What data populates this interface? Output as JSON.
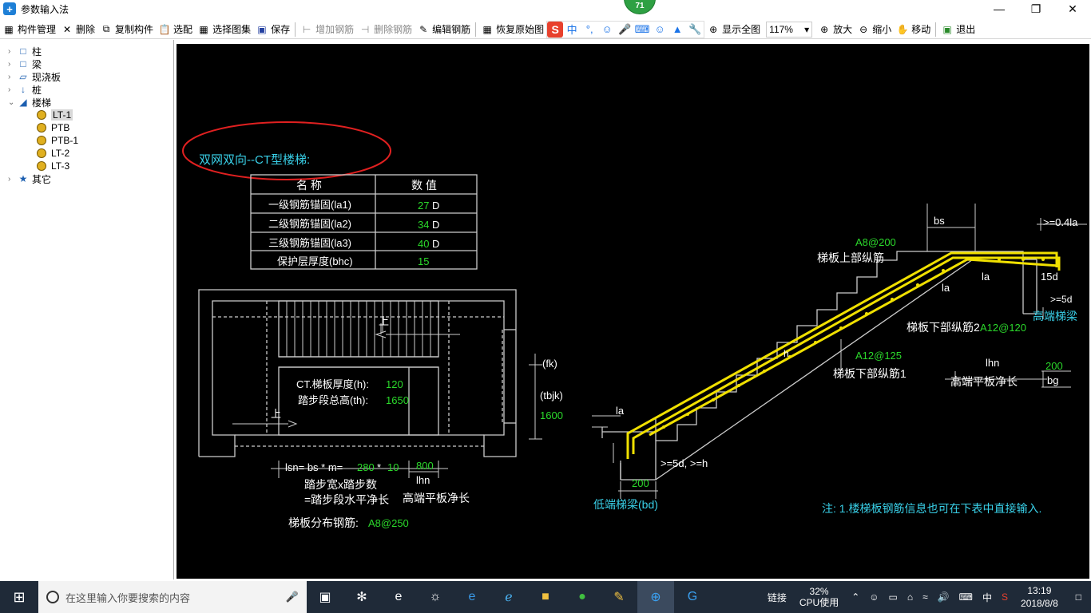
{
  "window": {
    "title": "参数输入法",
    "badge": "71"
  },
  "toolbar": {
    "items": [
      "构件管理",
      "删除",
      "复制构件",
      "选配",
      "选择图集",
      "保存",
      "增加钢筋",
      "删除钢筋",
      "编辑钢筋",
      "恢复原始图"
    ],
    "zoom_value": "117%",
    "right_items": [
      "显示全图",
      "放大",
      "缩小",
      "移动",
      "退出"
    ]
  },
  "tree": {
    "root": [
      "柱",
      "梁",
      "现浇板",
      "桩",
      "楼梯",
      "其它"
    ],
    "stairs_children": [
      "LT-1",
      "PTB",
      "PTB-1",
      "LT-2",
      "LT-3"
    ],
    "selected": "LT-1"
  },
  "drawing": {
    "title": "双网双向--CT型楼梯:",
    "table": {
      "headers": [
        "名  称",
        "数  值"
      ],
      "rows": [
        {
          "name": "一级钢筋锚固(la1)",
          "value": "27",
          "unit": "D"
        },
        {
          "name": "二级钢筋锚固(la2)",
          "value": "34",
          "unit": "D"
        },
        {
          "name": "三级钢筋锚固(la3)",
          "value": "40",
          "unit": "D"
        },
        {
          "name": "保护层厚度(bhc)",
          "value": "15",
          "unit": ""
        }
      ]
    },
    "plan": {
      "up1": "上",
      "up2": "上",
      "thickness_label": "CT.梯板厚度(h):",
      "thickness_value": "120",
      "height_label": "踏步段总高(th):",
      "height_value": "1650",
      "fk": "(fk)",
      "tbjk": "(tbjk)",
      "tbjk_value": "1600",
      "lsn_label": "lsn= bs * m=",
      "bs_value": "280",
      "star": "*",
      "m_value": "10",
      "lhn_value": "800",
      "lhn": "lhn",
      "desc1": "踏步宽x踏步数",
      "desc2": "=踏步段水平净长",
      "desc3": "高端平板净长",
      "dist_label": "梯板分布钢筋:",
      "dist_value": "A8@250"
    },
    "section": {
      "bs": "bs",
      "top_anchor": ">=0.4la",
      "top_bar_spec": "A8@200",
      "top_bar_label": "梯板上部纵筋",
      "la": "la",
      "d15": "15d",
      "d5": ">=5d",
      "bot2_label": "梯板下部纵筋2",
      "bot2_spec": "A12@120",
      "high_beam": "高端梯梁",
      "h": "h",
      "bot1_spec": "A12@125",
      "bot1_label": "梯板下部纵筋1",
      "lhn": "lhn",
      "lhn_desc": "高端平板净长",
      "bg_value": "200",
      "bg": "bg",
      "low_anchor": ">=5d, >=h",
      "bd_value": "200",
      "low_beam": "低端梯梁(bd)",
      "note": "注: 1.楼梯板钢筋信息也可在下表中直接输入."
    }
  },
  "taskbar": {
    "search_placeholder": "在这里输入你要搜索的内容",
    "link": "链接",
    "cpu_value": "32%",
    "cpu_label": "CPU使用",
    "ime": "中",
    "time": "13:19",
    "date": "2018/8/8"
  }
}
